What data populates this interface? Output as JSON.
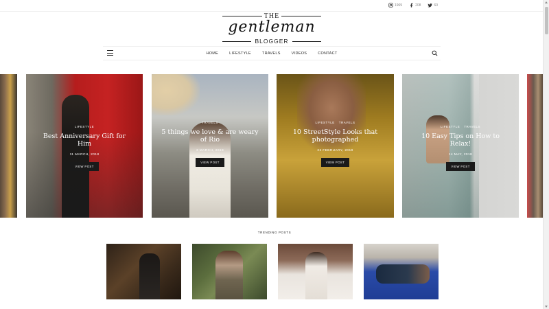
{
  "social": [
    {
      "icon": "instagram-icon",
      "count": "1969"
    },
    {
      "icon": "facebook-icon",
      "count": "208"
    },
    {
      "icon": "twitter-icon",
      "count": "60"
    }
  ],
  "logo": {
    "the": "THE",
    "script": "gentleman",
    "blogger": "BLOGGER"
  },
  "nav": {
    "items": [
      "HOME",
      "LIFESTYLE",
      "TRAVELS",
      "VIDEOS",
      "CONTACT"
    ]
  },
  "slides": [
    {
      "categories": [
        "LIFESTYLE"
      ],
      "title": "Best Anniversary Gift for Him",
      "date": "11 MARCH, 2018",
      "button": "VIEW POST"
    },
    {
      "categories": [
        "TRAVELS"
      ],
      "title": "5 things we love & are weary of Rio",
      "date": "3 MARCH, 2018",
      "button": "VIEW POST"
    },
    {
      "categories": [
        "LIFESTYLE",
        "TRAVELS"
      ],
      "title": "10 StreetStyle Looks that photographed",
      "date": "22 FEBRUARY, 2018",
      "button": "VIEW POST"
    },
    {
      "categories": [
        "LIFESTYLE",
        "TRAVELS"
      ],
      "title": "10 Easy Tips on How to Relax!",
      "date": "14 MAY, 2018",
      "button": "VIEW POST"
    }
  ],
  "trending": {
    "title": "TRENDING POSTS"
  },
  "colors": {
    "text": "#222222",
    "button_bg": "#1a1a1a",
    "border": "#eeeeee"
  }
}
